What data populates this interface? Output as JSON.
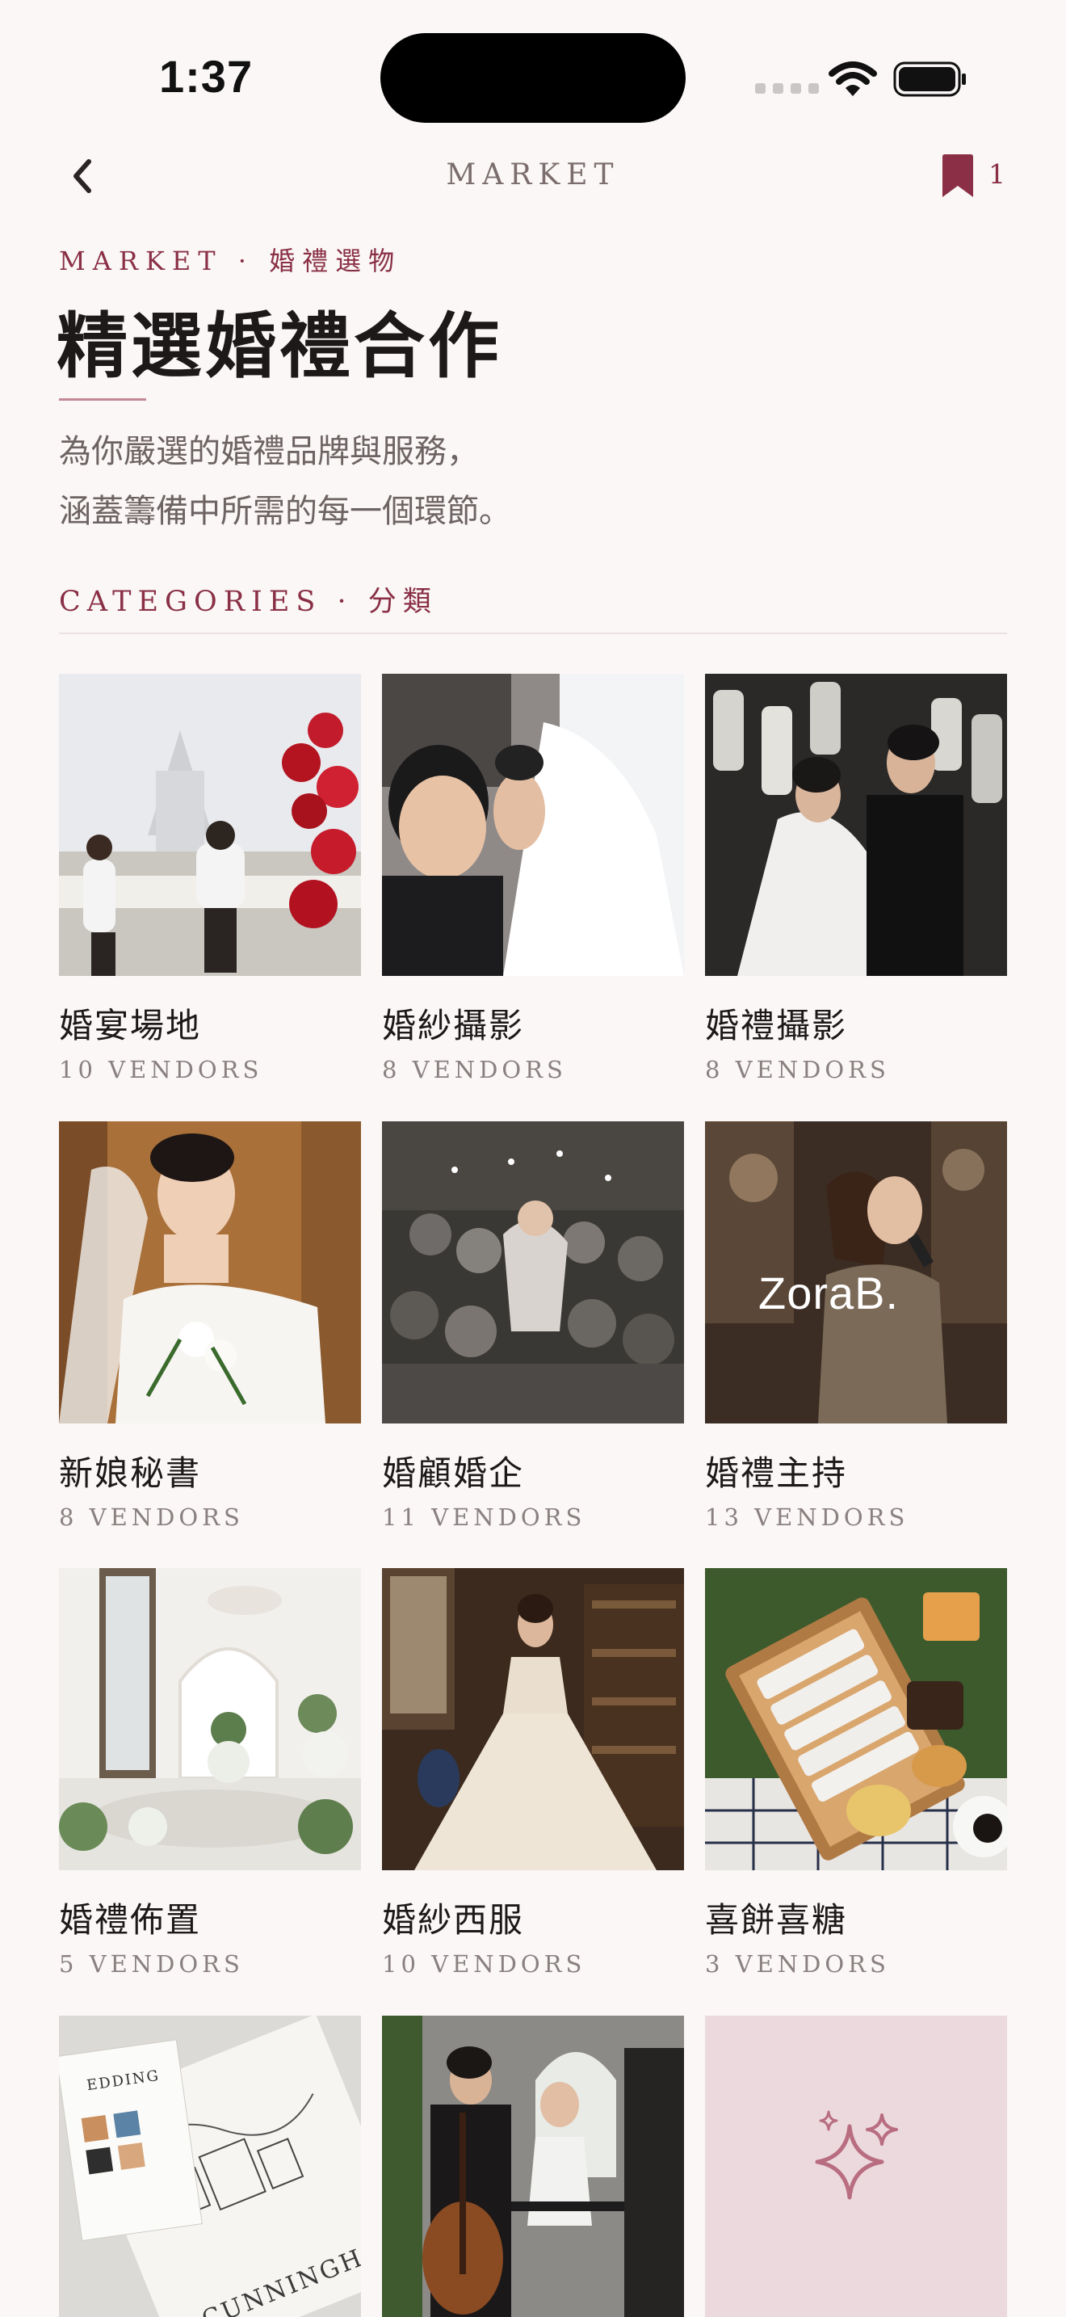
{
  "status_bar": {
    "time": "1:37"
  },
  "nav": {
    "title": "MARKET",
    "bookmark_count": "1"
  },
  "header": {
    "eyebrow": "MARKET · 婚禮選物",
    "title": "精選婚禮合作",
    "intro_line1": "為你嚴選的婚禮品牌與服務，",
    "intro_line2": "涵蓋籌備中所需的每一個環節。"
  },
  "categories": {
    "heading": "CATEGORIES · 分類",
    "items": [
      {
        "name": "婚宴場地",
        "count": "10 VENDORS"
      },
      {
        "name": "婚紗攝影",
        "count": "8 VENDORS"
      },
      {
        "name": "婚禮攝影",
        "count": "8 VENDORS"
      },
      {
        "name": "新娘秘書",
        "count": "8 VENDORS"
      },
      {
        "name": "婚顧婚企",
        "count": "11 VENDORS"
      },
      {
        "name": "婚禮主持",
        "count": "13 VENDORS"
      },
      {
        "name": "婚禮佈置",
        "count": "5 VENDORS"
      },
      {
        "name": "婚紗西服",
        "count": "10 VENDORS"
      },
      {
        "name": "喜餅喜糖",
        "count": "3 VENDORS"
      }
    ],
    "partial_images": {
      "invitation_text_1": "EDDING",
      "invitation_text_2": "CUNNINGHA",
      "host_logo": "ZoraB."
    }
  },
  "colors": {
    "accent": "#8a2f45",
    "background": "#faf7f6",
    "placeholder": "#ecd9dd"
  }
}
